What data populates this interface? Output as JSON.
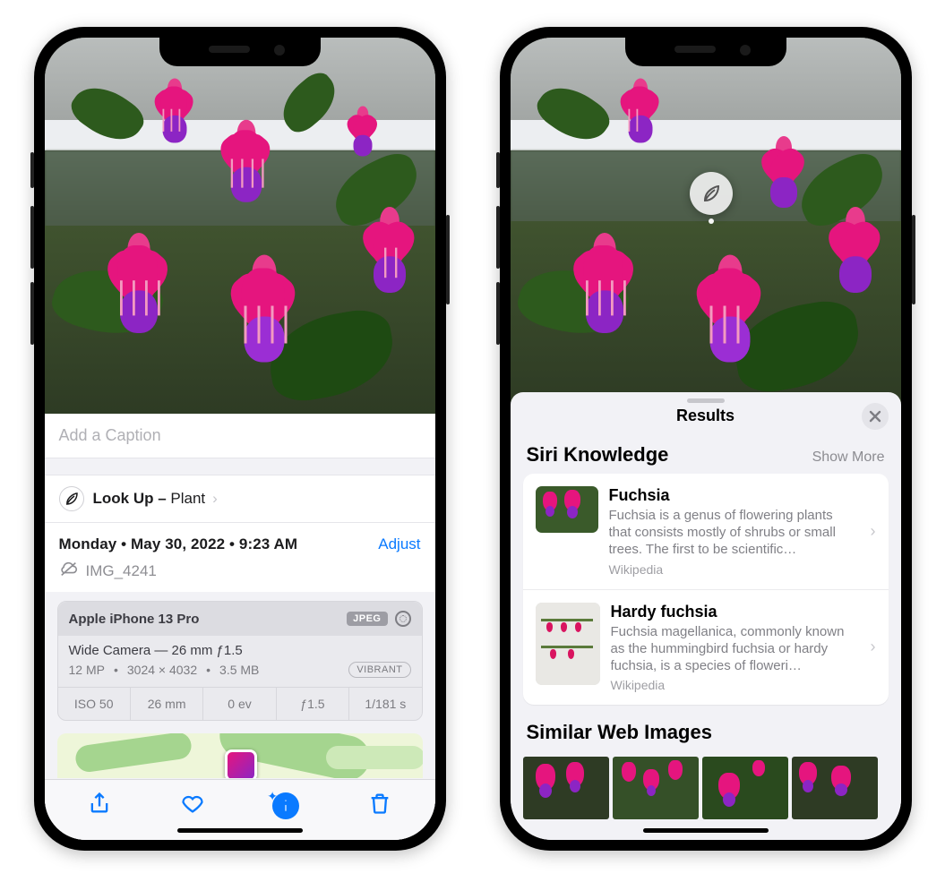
{
  "left": {
    "caption_placeholder": "Add a Caption",
    "lookup_prefix": "Look Up – ",
    "lookup_category": "Plant",
    "date_line": "Monday • May 30, 2022 • 9:23 AM",
    "adjust_label": "Adjust",
    "filename": "IMG_4241",
    "exif": {
      "device": "Apple iPhone 13 Pro",
      "format": "JPEG",
      "lens": "Wide Camera — 26 mm ƒ1.5",
      "mp": "12 MP",
      "dims": "3024 × 4032",
      "size": "3.5 MB",
      "style": "VIBRANT",
      "iso": "ISO 50",
      "focal": "26 mm",
      "ev": "0 ev",
      "aperture": "ƒ1.5",
      "shutter": "1/181 s"
    }
  },
  "right": {
    "sheet_title": "Results",
    "siri_heading": "Siri Knowledge",
    "show_more": "Show More",
    "results": [
      {
        "title": "Fuchsia",
        "desc": "Fuchsia is a genus of flowering plants that consists mostly of shrubs or small trees. The first to be scientific…",
        "source": "Wikipedia"
      },
      {
        "title": "Hardy fuchsia",
        "desc": "Fuchsia magellanica, commonly known as the hummingbird fuchsia or hardy fuchsia, is a species of floweri…",
        "source": "Wikipedia"
      }
    ],
    "similar_heading": "Similar Web Images"
  }
}
